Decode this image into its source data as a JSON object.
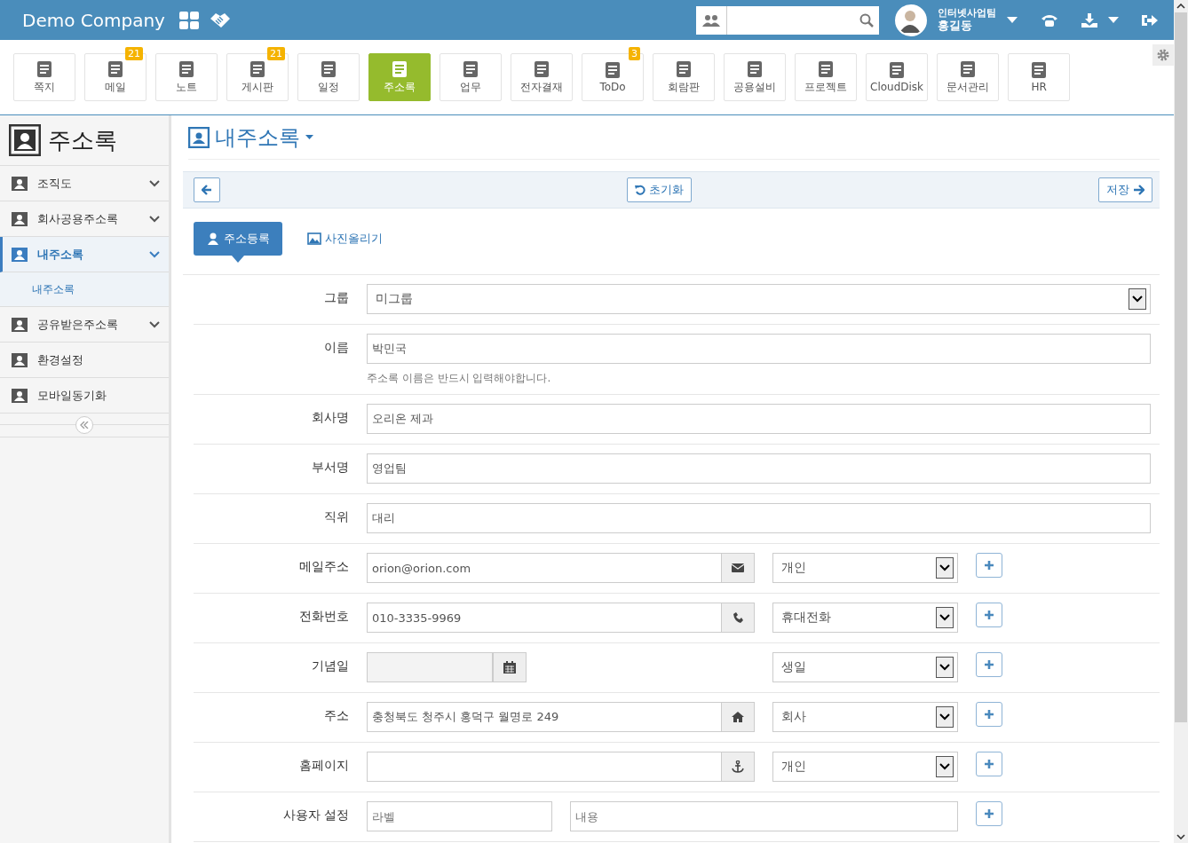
{
  "header": {
    "brand": "Demo Company",
    "user_team": "인터넷사업팀",
    "user_name": "홍길동"
  },
  "apps": [
    {
      "label": "쪽지",
      "selected": false
    },
    {
      "label": "메일",
      "badge": "21",
      "selected": false
    },
    {
      "label": "노트",
      "selected": false
    },
    {
      "label": "게시판",
      "badge": "21",
      "selected": false
    },
    {
      "label": "일정",
      "selected": false
    },
    {
      "label": "주소록",
      "selected": true
    },
    {
      "label": "업무",
      "selected": false
    },
    {
      "label": "전자결재",
      "selected": false
    },
    {
      "label": "ToDo",
      "badge": "3",
      "selected": false
    },
    {
      "label": "회람판",
      "selected": false
    },
    {
      "label": "공용설비",
      "selected": false
    },
    {
      "label": "프로젝트",
      "selected": false
    },
    {
      "label": "CloudDisk",
      "selected": false
    },
    {
      "label": "문서관리",
      "selected": false
    },
    {
      "label": "HR",
      "selected": false
    }
  ],
  "sidebar": {
    "title": "주소록",
    "items": [
      {
        "label": "조직도",
        "expandable": true,
        "selected": false
      },
      {
        "label": "회사공용주소록",
        "expandable": true,
        "selected": false
      },
      {
        "label": "내주소록",
        "expandable": true,
        "selected": true,
        "children": [
          {
            "label": "내주소록",
            "selected": true
          }
        ]
      },
      {
        "label": "공유받은주소록",
        "expandable": true,
        "selected": false
      },
      {
        "label": "환경설정",
        "expandable": false,
        "selected": false
      },
      {
        "label": "모바일동기화",
        "expandable": false,
        "selected": false
      }
    ]
  },
  "page_title": "내주소록",
  "toolbar": {
    "reset": "초기화",
    "save": "저장"
  },
  "tabs": [
    {
      "label": "주소등록",
      "selected": true
    },
    {
      "label": "사진올리기",
      "selected": false
    }
  ],
  "form": [
    {
      "kind": "select",
      "label": "그룹",
      "value": "미그룹"
    },
    {
      "kind": "text",
      "label": "이름",
      "value": "박민국",
      "hint": "주소록 이름은 반드시 입력해야합니다."
    },
    {
      "kind": "text",
      "label": "회사명",
      "value": "오리온 제과"
    },
    {
      "kind": "text",
      "label": "부서명",
      "value": "영업팀"
    },
    {
      "kind": "text",
      "label": "직위",
      "value": "대리"
    },
    {
      "kind": "email",
      "label": "메일주소",
      "value": "orion@orion.com",
      "type": "개인"
    },
    {
      "kind": "phone",
      "label": "전화번호",
      "value": "010-3335-9969",
      "type": "휴대전화"
    },
    {
      "kind": "date",
      "label": "기념일",
      "type": "생일"
    },
    {
      "kind": "address",
      "label": "주소",
      "value": "충청북도 청주시 홍덕구 월명로 249",
      "type": "회사"
    },
    {
      "kind": "homepage",
      "label": "홈페이지",
      "type": "개인"
    },
    {
      "kind": "custom",
      "label": "사용자 설정",
      "placeholder": "라벨",
      "placeholder_2": "내용"
    }
  ]
}
